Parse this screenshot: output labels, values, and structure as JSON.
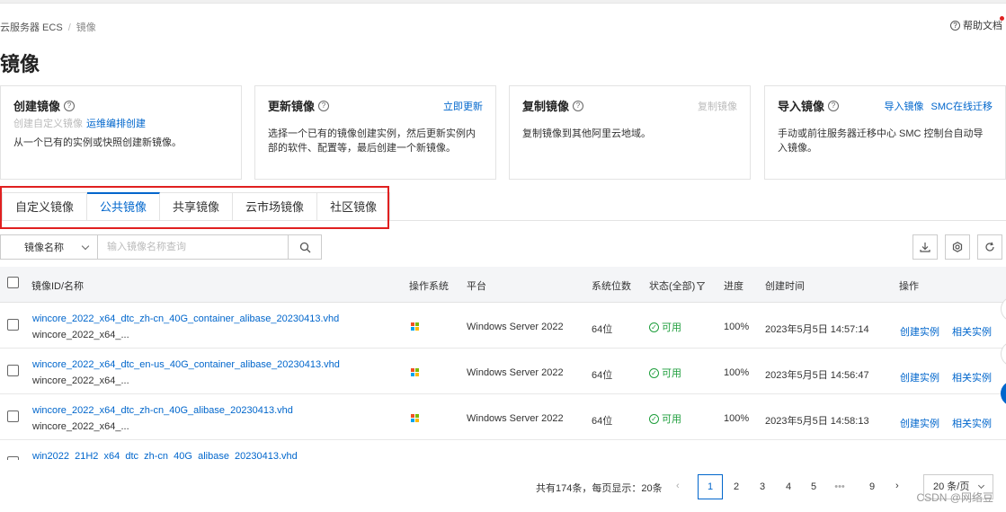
{
  "breadcrumb": {
    "root": "云服务器 ECS",
    "current": "镜像"
  },
  "help": {
    "label": "帮助文档"
  },
  "page": {
    "title": "镜像"
  },
  "cards": [
    {
      "title": "创建镜像",
      "sub_disabled": "创建自定义镜像",
      "sub_link": "运维编排创建",
      "desc": "从一个已有的实例或快照创建新镜像。",
      "actions": []
    },
    {
      "title": "更新镜像",
      "desc": "选择一个已有的镜像创建实例，然后更新实例内部的软件、配置等，最后创建一个新镜像。",
      "actions": [
        {
          "label": "立即更新",
          "enabled": true
        }
      ]
    },
    {
      "title": "复制镜像",
      "desc": "复制镜像到其他阿里云地域。",
      "actions": [
        {
          "label": "复制镜像",
          "enabled": false
        }
      ]
    },
    {
      "title": "导入镜像",
      "desc": "手动或前往服务器迁移中心 SMC 控制台自动导入镜像。",
      "actions": [
        {
          "label": "导入镜像",
          "enabled": true
        },
        {
          "label": "SMC在线迁移",
          "enabled": true
        }
      ]
    }
  ],
  "tabs": [
    {
      "label": "自定义镜像",
      "active": false
    },
    {
      "label": "公共镜像",
      "active": true
    },
    {
      "label": "共享镜像",
      "active": false
    },
    {
      "label": "云市场镜像",
      "active": false
    },
    {
      "label": "社区镜像",
      "active": false
    }
  ],
  "filter": {
    "field": "镜像名称",
    "placeholder": "输入镜像名称查询"
  },
  "table": {
    "columns": {
      "id": "镜像ID/名称",
      "os": "操作系统",
      "platform": "平台",
      "bits": "系统位数",
      "status": "状态(全部)",
      "progress": "进度",
      "created": "创建时间",
      "actions": "操作"
    },
    "rows": [
      {
        "id": "wincore_2022_x64_dtc_zh-cn_40G_container_alibase_20230413.vhd",
        "name": "wincore_2022_x64_...",
        "platform": "Windows Server 2022",
        "bits": "64位",
        "status": "可用",
        "progress": "100%",
        "created": "2023年5月5日 14:57:14",
        "act1": "创建实例",
        "act2": "相关实例"
      },
      {
        "id": "wincore_2022_x64_dtc_en-us_40G_container_alibase_20230413.vhd",
        "name": "wincore_2022_x64_...",
        "platform": "Windows Server 2022",
        "bits": "64位",
        "status": "可用",
        "progress": "100%",
        "created": "2023年5月5日 14:56:47",
        "act1": "创建实例",
        "act2": "相关实例"
      },
      {
        "id": "wincore_2022_x64_dtc_zh-cn_40G_alibase_20230413.vhd",
        "name": "wincore_2022_x64_...",
        "platform": "Windows Server 2022",
        "bits": "64位",
        "status": "可用",
        "progress": "100%",
        "created": "2023年5月5日 14:58:13",
        "act1": "创建实例",
        "act2": "相关实例"
      },
      {
        "id": "win2022_21H2_x64_dtc_zh-cn_40G_alibase_20230413.vhd",
        "name": "",
        "platform": "",
        "bits": "",
        "status": "",
        "progress": "",
        "created": "",
        "act1": "",
        "act2": ""
      }
    ]
  },
  "pagination": {
    "total": "共有174条，每页显示：20条",
    "pages": [
      "1",
      "2",
      "3",
      "4",
      "5",
      "•••",
      "9"
    ],
    "current": "1",
    "page_size": "20 条/页"
  },
  "watermark": "CSDN @网络豆",
  "colors": {
    "accent": "#0066cc",
    "highlight": "#e02020",
    "success": "#1e9e3c"
  }
}
